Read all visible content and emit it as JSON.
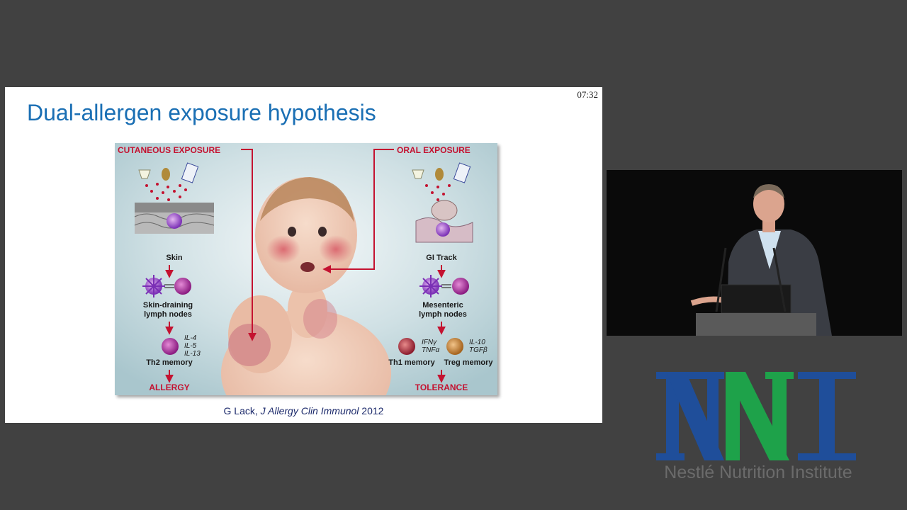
{
  "slide": {
    "title": "Dual-allergen exposure hypothesis",
    "timer": "07:32",
    "citation_author": "G Lack, ",
    "citation_journal": "J Allergy Clin Immunol",
    "citation_year": " 2012"
  },
  "figure": {
    "left_header": "CUTANEOUS EXPOSURE",
    "right_header": "ORAL EXPOSURE",
    "left_steps": {
      "skin": "Skin",
      "nodes_line1": "Skin-draining",
      "nodes_line2": "lymph nodes",
      "cytokines": [
        "IL-4",
        "IL-5",
        "IL-13"
      ],
      "memory": "Th2 memory",
      "outcome": "ALLERGY"
    },
    "right_steps": {
      "gi": "GI Track",
      "nodes_line1": "Mesenteric",
      "nodes_line2": "lymph nodes",
      "th1_cytokines": [
        "IFNγ",
        "TNFα"
      ],
      "treg_cytokines": [
        "IL-10",
        "TGFβ"
      ],
      "th1_memory": "Th1 memory",
      "treg_memory": "Treg memory",
      "outcome": "TOLERANCE"
    }
  },
  "logo": {
    "letters": "NNI",
    "text": "Nestlé Nutrition Institute",
    "colors": {
      "blue": "#1f4e9a",
      "green": "#1ea24a"
    }
  }
}
